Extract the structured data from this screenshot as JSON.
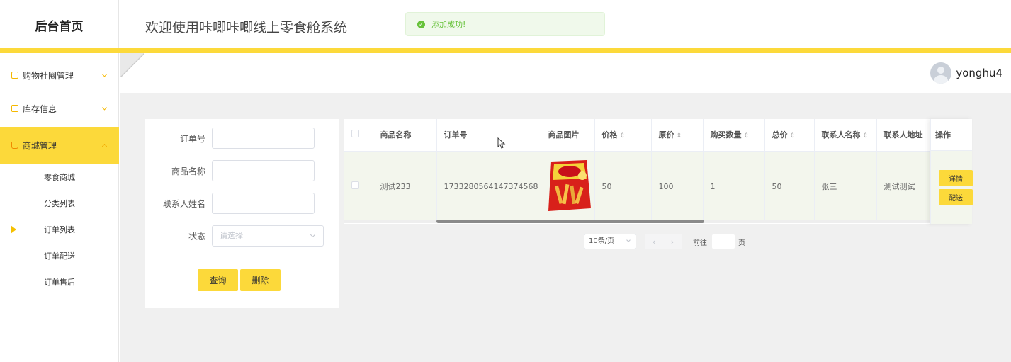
{
  "header": {
    "brand": "后台首页",
    "welcome": "欢迎使用咔唧咔唧线上零食舱系统",
    "toast": "添加成功!"
  },
  "user": {
    "name": "yonghu4"
  },
  "sidebar": {
    "menus": [
      {
        "label": "购物社圈管理"
      },
      {
        "label": "库存信息"
      },
      {
        "label": "商城管理"
      }
    ],
    "sub_items": [
      {
        "label": "零食商城"
      },
      {
        "label": "分类列表"
      },
      {
        "label": "订单列表"
      },
      {
        "label": "订单配送"
      },
      {
        "label": "订单售后"
      }
    ]
  },
  "search": {
    "order_no_label": "订单号",
    "product_name_label": "商品名称",
    "contact_label": "联系人姓名",
    "status_label": "状态",
    "status_placeholder": "请选择",
    "query_button": "查询",
    "delete_button": "删除"
  },
  "table": {
    "headers": {
      "product_name": "商品名称",
      "order_no": "订单号",
      "image": "商品图片",
      "price": "价格",
      "original_price": "原价",
      "quantity": "购买数量",
      "total": "总价",
      "contact_name": "联系人名称",
      "contact_address": "联系人地址",
      "actions": "操作"
    },
    "rows": [
      {
        "product_name": "测试233",
        "order_no": "1733280564147374568",
        "price": "50",
        "original_price": "100",
        "quantity": "1",
        "total": "50",
        "contact_name": "张三",
        "contact_address": "测试测试"
      }
    ],
    "detail_button": "详情",
    "deliver_button": "配送"
  },
  "pagination": {
    "page_size": "10条/页",
    "goto_label": "前往",
    "page_word": "页"
  }
}
